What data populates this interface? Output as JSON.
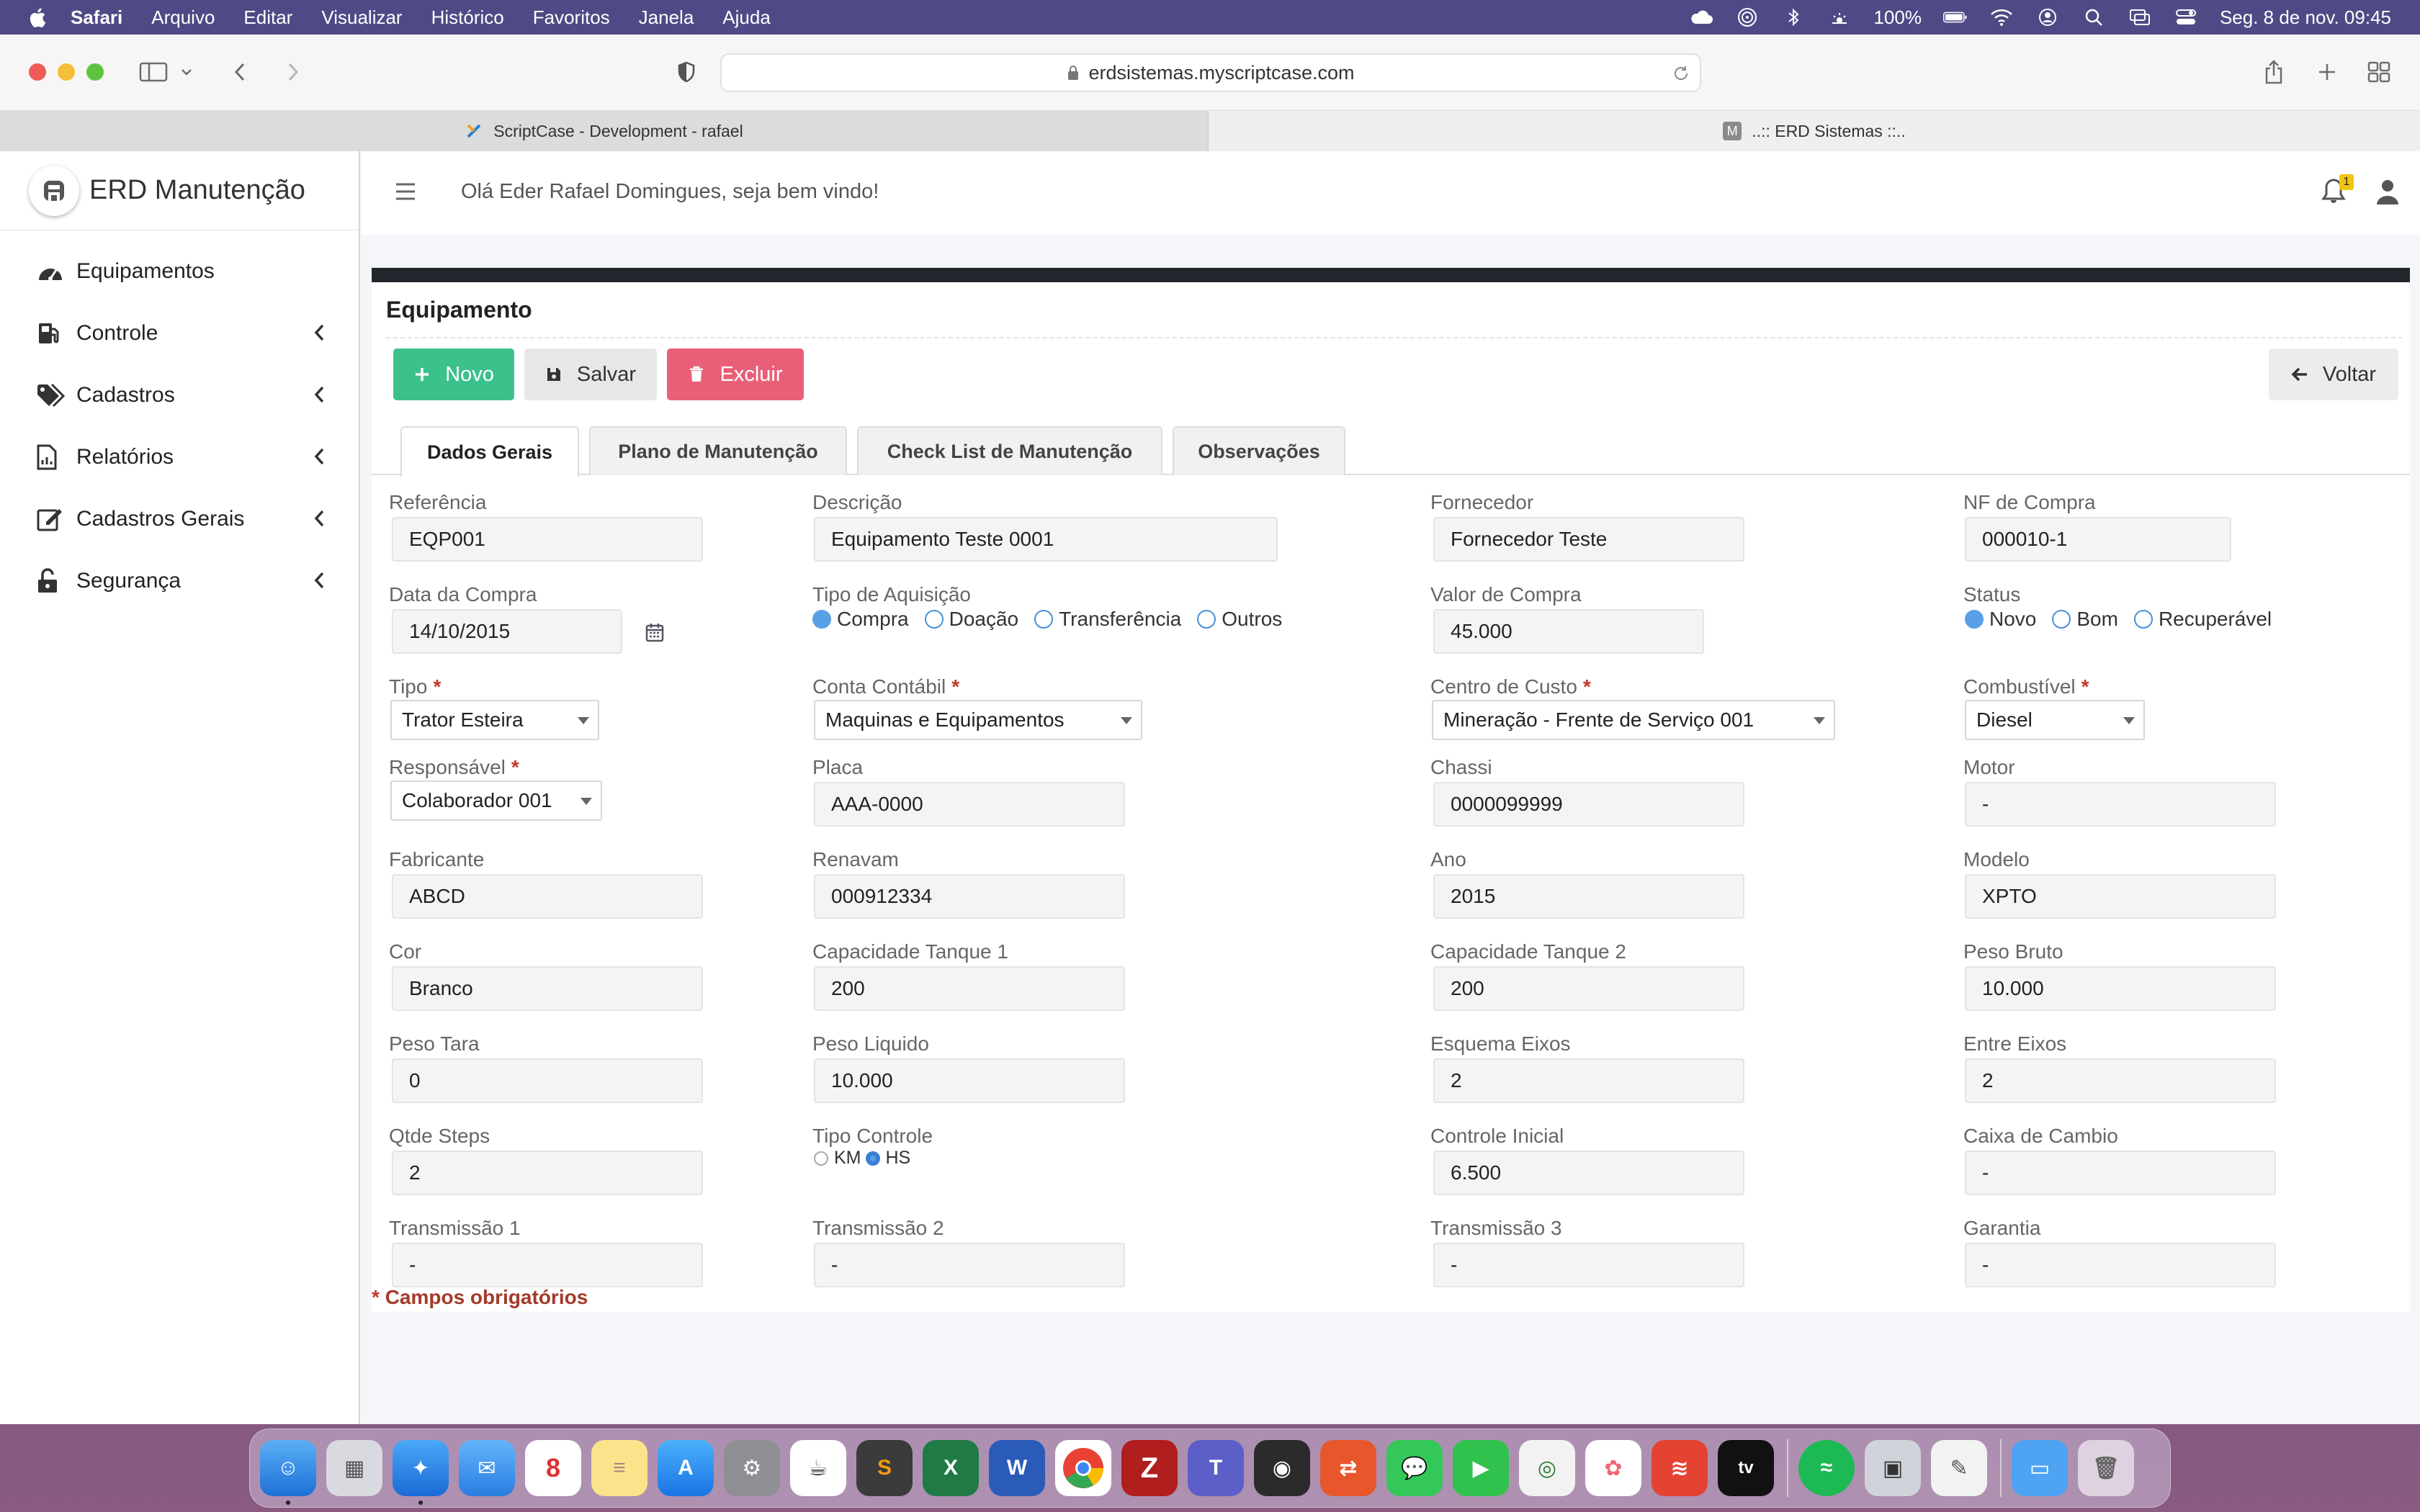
{
  "menubar": {
    "app": "Safari",
    "items": [
      "Arquivo",
      "Editar",
      "Visualizar",
      "Histórico",
      "Favoritos",
      "Janela",
      "Ajuda"
    ],
    "battery": "100%",
    "datetime": "Seg. 8 de nov.  09:45"
  },
  "browser": {
    "url": "erdsistemas.myscriptcase.com",
    "tabs": [
      {
        "title": "ScriptCase - Development - rafael"
      },
      {
        "title": "..:: ERD Sistemas ::.."
      }
    ]
  },
  "sidebar": {
    "brand": "ERD Manutenção",
    "items": [
      {
        "label": "Equipamentos",
        "icon": "gauge-icon",
        "expandable": false
      },
      {
        "label": "Controle",
        "icon": "fuel-pump-icon",
        "expandable": true
      },
      {
        "label": "Cadastros",
        "icon": "tags-icon",
        "expandable": true
      },
      {
        "label": "Relatórios",
        "icon": "report-icon",
        "expandable": true
      },
      {
        "label": "Cadastros Gerais",
        "icon": "edit-icon",
        "expandable": true
      },
      {
        "label": "Segurança",
        "icon": "unlock-icon",
        "expandable": true
      }
    ]
  },
  "topbar": {
    "welcome": "Olá Eder Rafael Domingues, seja bem vindo!",
    "notifications": "1"
  },
  "page": {
    "title": "Equipamento",
    "buttons": {
      "novo": "Novo",
      "salvar": "Salvar",
      "excluir": "Excluir",
      "voltar": "Voltar"
    },
    "tabs": [
      "Dados Gerais",
      "Plano de Manutenção",
      "Check List de Manutenção",
      "Observações"
    ],
    "required_note": "Campos obrigatórios"
  },
  "form": {
    "referencia": {
      "label": "Referência",
      "value": "EQP001"
    },
    "descricao": {
      "label": "Descrição",
      "value": "Equipamento Teste 0001"
    },
    "fornecedor": {
      "label": "Fornecedor",
      "value": "Fornecedor Teste"
    },
    "nf_compra": {
      "label": "NF de Compra",
      "value": "000010-1"
    },
    "data_compra": {
      "label": "Data da Compra",
      "value": "14/10/2015"
    },
    "tipo_aquisicao": {
      "label": "Tipo de Aquisição",
      "options": [
        "Compra",
        "Doação",
        "Transferência",
        "Outros"
      ],
      "selected": "Compra"
    },
    "valor_compra": {
      "label": "Valor de Compra",
      "value": "45.000"
    },
    "status": {
      "label": "Status",
      "options": [
        "Novo",
        "Bom",
        "Recuperável"
      ],
      "selected": "Novo"
    },
    "tipo": {
      "label": "Tipo",
      "value": "Trator Esteira"
    },
    "conta_contabil": {
      "label": "Conta Contábil",
      "value": "Maquinas e Equipamentos"
    },
    "centro_custo": {
      "label": "Centro de Custo",
      "value": "Mineração - Frente de Serviço 001"
    },
    "combustivel": {
      "label": "Combustível",
      "value": "Diesel"
    },
    "responsavel": {
      "label": "Responsável",
      "value": "Colaborador 001"
    },
    "placa": {
      "label": "Placa",
      "value": "AAA-0000"
    },
    "chassi": {
      "label": "Chassi",
      "value": "0000099999"
    },
    "motor": {
      "label": "Motor",
      "value": "-"
    },
    "fabricante": {
      "label": "Fabricante",
      "value": "ABCD"
    },
    "renavam": {
      "label": "Renavam",
      "value": "000912334"
    },
    "ano": {
      "label": "Ano",
      "value": "2015"
    },
    "modelo": {
      "label": "Modelo",
      "value": "XPTO"
    },
    "cor": {
      "label": "Cor",
      "value": "Branco"
    },
    "cap_tanque1": {
      "label": "Capacidade Tanque 1",
      "value": "200"
    },
    "cap_tanque2": {
      "label": "Capacidade Tanque 2",
      "value": "200"
    },
    "peso_bruto": {
      "label": "Peso Bruto",
      "value": "10.000"
    },
    "peso_tara": {
      "label": "Peso Tara",
      "value": "0"
    },
    "peso_liquido": {
      "label": "Peso Liquido",
      "value": "10.000"
    },
    "esquema_eixos": {
      "label": "Esquema Eixos",
      "value": "2"
    },
    "entre_eixos": {
      "label": "Entre Eixos",
      "value": "2"
    },
    "qtde_steps": {
      "label": "Qtde Steps",
      "value": "2"
    },
    "tipo_controle": {
      "label": "Tipo Controle",
      "options": [
        "KM",
        "HS"
      ],
      "selected": "HS"
    },
    "controle_inicial": {
      "label": "Controle Inicial",
      "value": "6.500"
    },
    "caixa_cambio": {
      "label": "Caixa de Cambio",
      "value": "-"
    },
    "transmissao1": {
      "label": "Transmissão 1",
      "value": "-"
    },
    "transmissao2": {
      "label": "Transmissão 2",
      "value": "-"
    },
    "transmissao3": {
      "label": "Transmissão 3",
      "value": "-"
    },
    "garantia": {
      "label": "Garantia",
      "value": "-"
    }
  },
  "colors": {
    "accent_green": "#3dc18c",
    "accent_red": "#e95f78",
    "required_red": "#c0392b",
    "header_dark": "#23262d"
  }
}
